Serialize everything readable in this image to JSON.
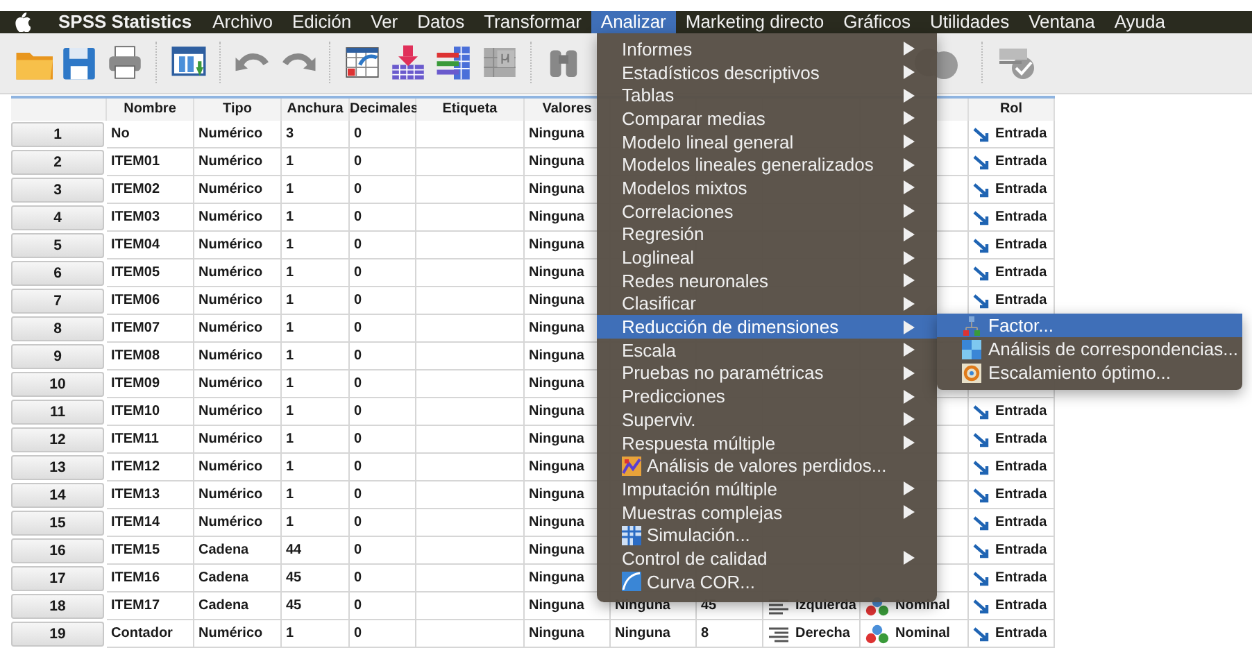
{
  "menubar": {
    "app": "SPSS Statistics",
    "items": [
      {
        "label": "Archivo",
        "selected": false
      },
      {
        "label": "Edición",
        "selected": false
      },
      {
        "label": "Ver",
        "selected": false
      },
      {
        "label": "Datos",
        "selected": false
      },
      {
        "label": "Transformar",
        "selected": false
      },
      {
        "label": "Analizar",
        "selected": true
      },
      {
        "label": "Marketing directo",
        "selected": false
      },
      {
        "label": "Gráficos",
        "selected": false
      },
      {
        "label": "Utilidades",
        "selected": false
      },
      {
        "label": "Ventana",
        "selected": false
      },
      {
        "label": "Ayuda",
        "selected": false
      }
    ]
  },
  "table": {
    "columns": [
      "Nombre",
      "Tipo",
      "Anchura",
      "Decimales",
      "Etiqueta",
      "Valores",
      null,
      null,
      null,
      null,
      "Rol"
    ],
    "rows": [
      {
        "number": "1",
        "cells": [
          "No",
          "Numérico",
          "3",
          "0",
          null,
          "Ninguna",
          null,
          null,
          null,
          null,
          {
            "text": "Entrada",
            "kind": "role"
          }
        ]
      },
      {
        "number": "2",
        "cells": [
          "ITEM01",
          "Numérico",
          "1",
          "0",
          null,
          "Ninguna",
          null,
          null,
          null,
          null,
          {
            "text": "Entrada",
            "kind": "role"
          }
        ]
      },
      {
        "number": "3",
        "cells": [
          "ITEM02",
          "Numérico",
          "1",
          "0",
          null,
          "Ninguna",
          null,
          null,
          null,
          null,
          {
            "text": "Entrada",
            "kind": "role"
          }
        ]
      },
      {
        "number": "4",
        "cells": [
          "ITEM03",
          "Numérico",
          "1",
          "0",
          null,
          "Ninguna",
          null,
          null,
          null,
          null,
          {
            "text": "Entrada",
            "kind": "role"
          }
        ]
      },
      {
        "number": "5",
        "cells": [
          "ITEM04",
          "Numérico",
          "1",
          "0",
          null,
          "Ninguna",
          null,
          null,
          null,
          null,
          {
            "text": "Entrada",
            "kind": "role"
          }
        ]
      },
      {
        "number": "6",
        "cells": [
          "ITEM05",
          "Numérico",
          "1",
          "0",
          null,
          "Ninguna",
          null,
          null,
          null,
          null,
          {
            "text": "Entrada",
            "kind": "role"
          }
        ]
      },
      {
        "number": "7",
        "cells": [
          "ITEM06",
          "Numérico",
          "1",
          "0",
          null,
          "Ninguna",
          null,
          null,
          null,
          null,
          {
            "text": "Entrada",
            "kind": "role"
          }
        ]
      },
      {
        "number": "8",
        "cells": [
          "ITEM07",
          "Numérico",
          "1",
          "0",
          null,
          "Ninguna",
          null,
          null,
          null,
          null,
          null
        ]
      },
      {
        "number": "9",
        "cells": [
          "ITEM08",
          "Numérico",
          "1",
          "0",
          null,
          "Ninguna",
          null,
          null,
          null,
          null,
          null
        ]
      },
      {
        "number": "10",
        "cells": [
          "ITEM09",
          "Numérico",
          "1",
          "0",
          null,
          "Ninguna",
          null,
          null,
          null,
          null,
          null
        ]
      },
      {
        "number": "11",
        "cells": [
          "ITEM10",
          "Numérico",
          "1",
          "0",
          null,
          "Ninguna",
          null,
          null,
          null,
          null,
          {
            "text": "Entrada",
            "kind": "role"
          }
        ]
      },
      {
        "number": "12",
        "cells": [
          "ITEM11",
          "Numérico",
          "1",
          "0",
          null,
          "Ninguna",
          null,
          null,
          null,
          null,
          {
            "text": "Entrada",
            "kind": "role"
          }
        ]
      },
      {
        "number": "13",
        "cells": [
          "ITEM12",
          "Numérico",
          "1",
          "0",
          null,
          "Ninguna",
          null,
          null,
          null,
          null,
          {
            "text": "Entrada",
            "kind": "role"
          }
        ]
      },
      {
        "number": "14",
        "cells": [
          "ITEM13",
          "Numérico",
          "1",
          "0",
          null,
          "Ninguna",
          null,
          null,
          null,
          null,
          {
            "text": "Entrada",
            "kind": "role"
          }
        ]
      },
      {
        "number": "15",
        "cells": [
          "ITEM14",
          "Numérico",
          "1",
          "0",
          null,
          "Ninguna",
          null,
          null,
          null,
          null,
          {
            "text": "Entrada",
            "kind": "role"
          }
        ]
      },
      {
        "number": "16",
        "cells": [
          "ITEM15",
          "Cadena",
          "44",
          "0",
          null,
          "Ninguna",
          null,
          null,
          null,
          null,
          {
            "text": "Entrada",
            "kind": "role"
          }
        ]
      },
      {
        "number": "17",
        "cells": [
          "ITEM16",
          "Cadena",
          "45",
          "0",
          null,
          "Ninguna",
          null,
          null,
          null,
          null,
          {
            "text": "Entrada",
            "kind": "role"
          }
        ]
      },
      {
        "number": "18",
        "cells": [
          "ITEM17",
          "Cadena",
          "45",
          "0",
          null,
          "Ninguna",
          "Ninguna",
          "45",
          {
            "text": "Izquierda",
            "kind": "left-align"
          },
          {
            "text": "Nominal",
            "kind": "nominal"
          },
          {
            "text": "Entrada",
            "kind": "role"
          }
        ]
      },
      {
        "number": "19",
        "cells": [
          "Contador",
          "Numérico",
          "1",
          "0",
          null,
          "Ninguna",
          "Ninguna",
          "8",
          {
            "text": "Derecha",
            "kind": "right-align"
          },
          {
            "text": "Nominal",
            "kind": "nominal"
          },
          {
            "text": "Entrada",
            "kind": "role"
          }
        ]
      }
    ]
  },
  "menu": {
    "items": [
      {
        "label": "Informes",
        "kind": "plain",
        "submenu": true,
        "selected": false
      },
      {
        "label": "Estadísticos descriptivos",
        "kind": "plain",
        "submenu": true,
        "selected": false
      },
      {
        "label": "Tablas",
        "kind": "plain",
        "submenu": true,
        "selected": false
      },
      {
        "label": "Comparar medias",
        "kind": "plain",
        "submenu": true,
        "selected": false
      },
      {
        "label": "Modelo lineal general",
        "kind": "plain",
        "submenu": true,
        "selected": false
      },
      {
        "label": "Modelos lineales generalizados",
        "kind": "plain",
        "submenu": true,
        "selected": false
      },
      {
        "label": "Modelos mixtos",
        "kind": "plain",
        "submenu": true,
        "selected": false
      },
      {
        "label": "Correlaciones",
        "kind": "plain",
        "submenu": true,
        "selected": false
      },
      {
        "label": "Regresión",
        "kind": "plain",
        "submenu": true,
        "selected": false
      },
      {
        "label": "Loglineal",
        "kind": "plain",
        "submenu": true,
        "selected": false
      },
      {
        "label": "Redes neuronales",
        "kind": "plain",
        "submenu": true,
        "selected": false
      },
      {
        "label": "Clasificar",
        "kind": "plain",
        "submenu": true,
        "selected": false
      },
      {
        "label": "Reducción de dimensiones",
        "kind": "plain",
        "submenu": true,
        "selected": true
      },
      {
        "label": "Escala",
        "kind": "plain",
        "submenu": true,
        "selected": false
      },
      {
        "label": "Pruebas no paramétricas",
        "kind": "plain",
        "submenu": true,
        "selected": false
      },
      {
        "label": "Predicciones",
        "kind": "plain",
        "submenu": true,
        "selected": false
      },
      {
        "label": "Superviv.",
        "kind": "plain",
        "submenu": true,
        "selected": false
      },
      {
        "label": "Respuesta múltiple",
        "kind": "plain",
        "submenu": true,
        "selected": false
      },
      {
        "label": "Análisis de valores perdidos...",
        "kind": "missing",
        "submenu": false,
        "selected": false
      },
      {
        "label": "Imputación múltiple",
        "kind": "plain",
        "submenu": true,
        "selected": false
      },
      {
        "label": "Muestras complejas",
        "kind": "plain",
        "submenu": true,
        "selected": false
      },
      {
        "label": "Simulación...",
        "kind": "simulation",
        "submenu": false,
        "selected": false
      },
      {
        "label": "Control de calidad",
        "kind": "plain",
        "submenu": true,
        "selected": false
      },
      {
        "label": "Curva COR...",
        "kind": "roc",
        "submenu": false,
        "selected": false
      }
    ]
  },
  "submenu": {
    "items": [
      {
        "label": "Factor...",
        "kind": "factor",
        "selected": true
      },
      {
        "label": "Análisis de correspondencias...",
        "kind": "correspondence",
        "selected": false
      },
      {
        "label": "Escalamiento óptimo...",
        "kind": "scaling",
        "selected": false
      }
    ]
  }
}
